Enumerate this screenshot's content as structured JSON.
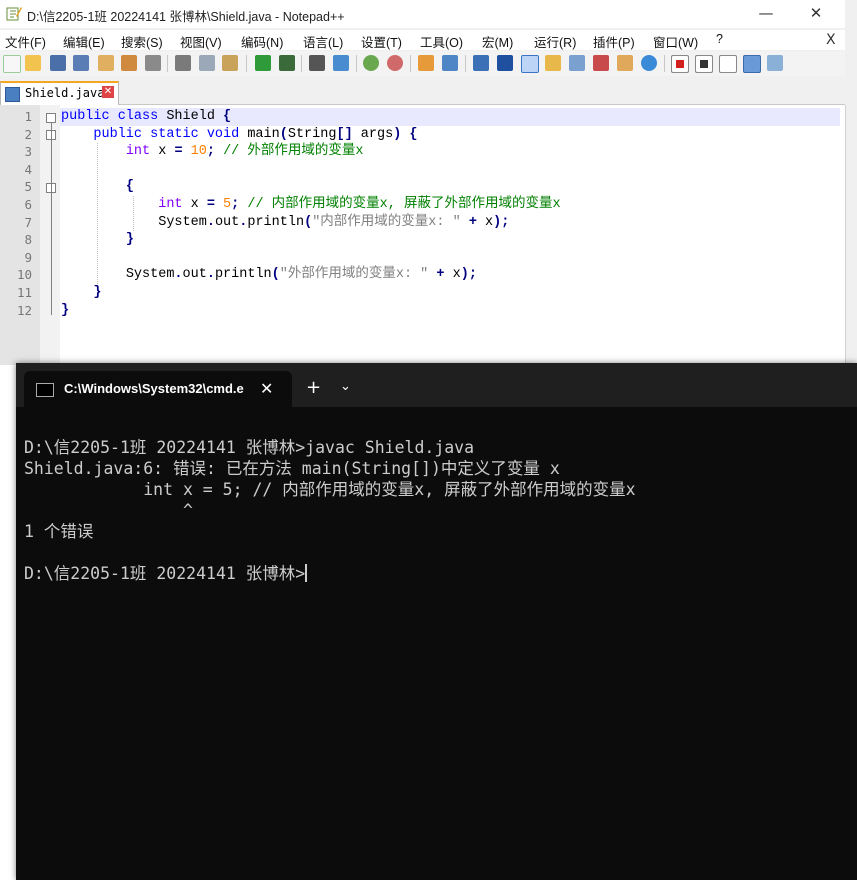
{
  "notepad": {
    "title": "D:\\信2205-1班 20224141 张博林\\Shield.java - Notepad++",
    "window_controls": {
      "minimize": "—",
      "maximize": "☐",
      "close": "✕"
    },
    "menu": [
      "文件(F)",
      "编辑(E)",
      "搜索(S)",
      "视图(V)",
      "编码(N)",
      "语言(L)",
      "设置(T)",
      "工具(O)",
      "宏(M)",
      "运行(R)",
      "插件(P)",
      "窗口(W)",
      "?"
    ],
    "menu_close": "X",
    "tab": {
      "label": "Shield.java",
      "close": "✕"
    },
    "line_numbers": [
      "1",
      "2",
      "3",
      "4",
      "5",
      "6",
      "7",
      "8",
      "9",
      "10",
      "11",
      "12"
    ],
    "code": {
      "l1_kw": "public class",
      "l1_rest": " Shield ",
      "brace_open": "{",
      "brace_close": "}",
      "l2_kw": "public static void",
      "l2_mid": " main",
      "l2_paren": "(",
      "l2_type": "String",
      "l2_arr": "[]",
      "l2_arg": " args",
      "l2_close": ")",
      "int_kw": "int",
      "var_x": " x ",
      "eq": "=",
      "l3_num": " 10",
      "semi": ";",
      "l3_cmt": " // 外部作用域的变量x",
      "l6_num": " 5",
      "l6_cmt": " // 内部作用域的变量x, 屏蔽了外部作用域的变量x",
      "sys": "System",
      "dot": ".",
      "out": "out",
      "println": "println",
      "l7_str": "\"内部作用域的变量x: \"",
      "l10_str": "\"外部作用域的变量x: \"",
      "plus": "+",
      "x": " x",
      "call_close": ")"
    }
  },
  "terminal": {
    "tab_title": "C:\\Windows\\System32\\cmd.e",
    "tab_close": "✕",
    "new_tab": "+",
    "dropdown": "⌄",
    "lines": [
      "D:\\信2205-1班 20224141 张博林>javac Shield.java",
      "Shield.java:6: 错误: 已在方法 main(String[])中定义了变量 x",
      "            int x = 5; // 内部作用域的变量x, 屏蔽了外部作用域的变量x",
      "                ^",
      "1 个错误",
      "D:\\信2205-1班 20224141 张博林>"
    ]
  }
}
